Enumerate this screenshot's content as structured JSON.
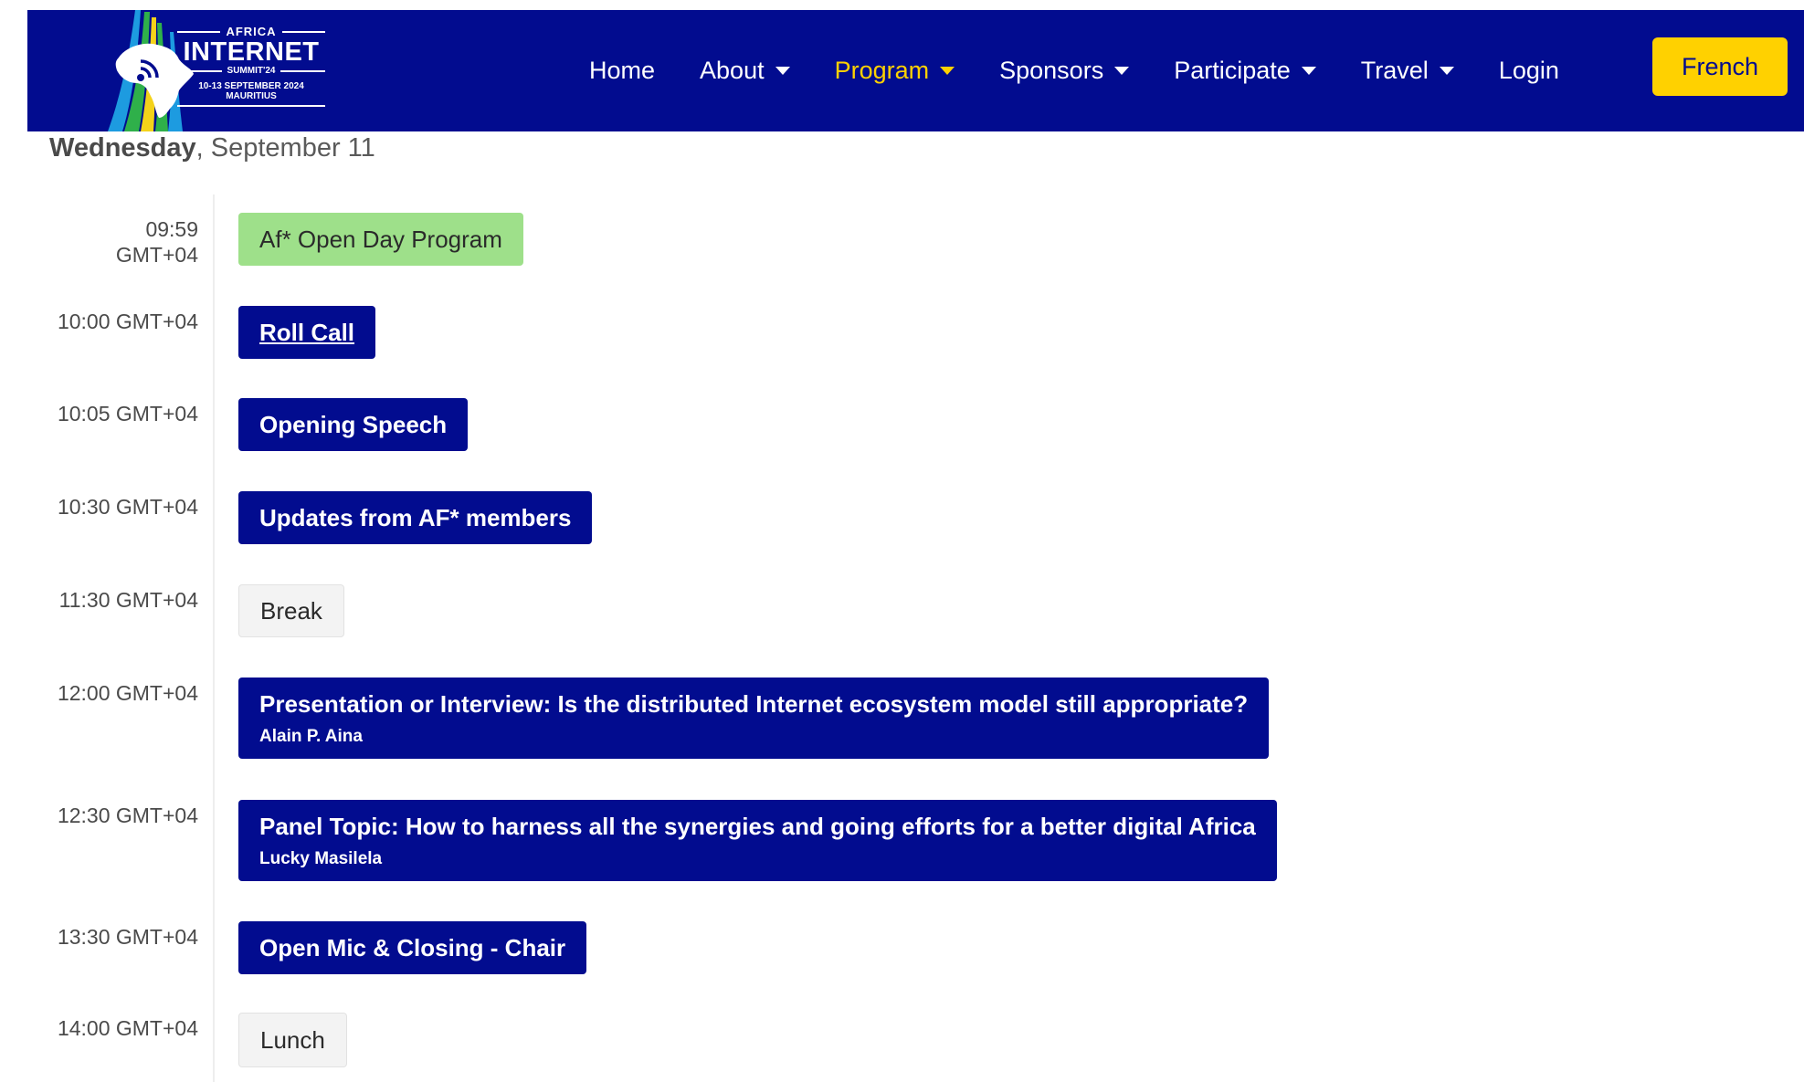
{
  "colors": {
    "navbar_bg": "#020c8f",
    "accent": "#ffd100",
    "program_block": "#9ee08a",
    "talk_block": "#020c8f",
    "break_block": "#f3f3f3"
  },
  "logo": {
    "top_text": "AFRICA",
    "main_text": "INTERNET",
    "sub_text": "SUMMIT'24",
    "dates": "10-13 SEPTEMBER 2024",
    "place": "MAURITIUS"
  },
  "nav": {
    "items": [
      {
        "label": "Home",
        "dropdown": false,
        "active": false
      },
      {
        "label": "About",
        "dropdown": true,
        "active": false
      },
      {
        "label": "Program",
        "dropdown": true,
        "active": true
      },
      {
        "label": "Sponsors",
        "dropdown": true,
        "active": false
      },
      {
        "label": "Participate",
        "dropdown": true,
        "active": false
      },
      {
        "label": "Travel",
        "dropdown": true,
        "active": false
      },
      {
        "label": "Login",
        "dropdown": false,
        "active": false
      }
    ],
    "language_button": "French"
  },
  "day": {
    "weekday": "Wednesday",
    "separator": ",",
    "date": " September 11"
  },
  "schedule": [
    {
      "time_line1": "09:59",
      "time_line2": "GMT+04",
      "title": "Af* Open Day Program",
      "speaker": "",
      "kind": "program"
    },
    {
      "time_line1": "10:00 GMT+04",
      "time_line2": "",
      "title": "Roll Call",
      "speaker": "",
      "kind": "talk-link"
    },
    {
      "time_line1": "10:05 GMT+04",
      "time_line2": "",
      "title": "Opening Speech",
      "speaker": "",
      "kind": "talk"
    },
    {
      "time_line1": "10:30 GMT+04",
      "time_line2": "",
      "title": "Updates from AF* members",
      "speaker": "",
      "kind": "talk"
    },
    {
      "time_line1": "11:30 GMT+04",
      "time_line2": "",
      "title": "Break",
      "speaker": "",
      "kind": "break"
    },
    {
      "time_line1": "12:00 GMT+04",
      "time_line2": "",
      "title": "Presentation or Interview: Is the distributed Internet ecosystem model still appropriate?",
      "speaker": "Alain P. Aina",
      "kind": "talk"
    },
    {
      "time_line1": "12:30 GMT+04",
      "time_line2": "",
      "title": "Panel Topic: How to harness all the synergies and going efforts for a better digital Africa",
      "speaker": "Lucky Masilela",
      "kind": "talk"
    },
    {
      "time_line1": "13:30 GMT+04",
      "time_line2": "",
      "title": "Open Mic & Closing - Chair",
      "speaker": "",
      "kind": "talk"
    },
    {
      "time_line1": "14:00 GMT+04",
      "time_line2": "",
      "title": "Lunch",
      "speaker": "",
      "kind": "break"
    }
  ]
}
